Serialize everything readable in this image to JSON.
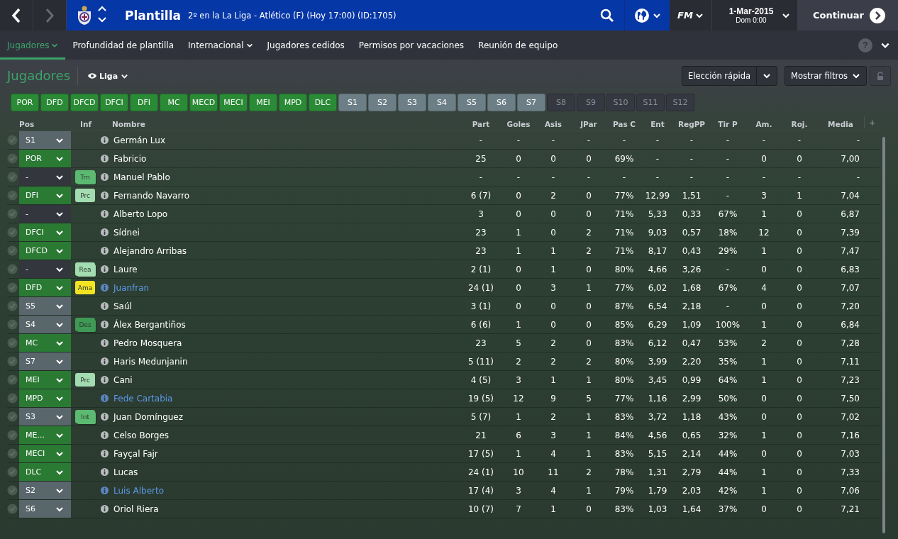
{
  "topbar": {
    "back_disabled": false,
    "forward_disabled": true,
    "title": "Plantilla",
    "subtitle": "2º en la La Liga - Atlético (F) (Hoy 17:00) (ID:1705)",
    "logo": "FM",
    "date": "1-Mar-2015",
    "time": "Dom 0:00",
    "continue": "Continuar"
  },
  "nav": [
    {
      "label": "Jugadores",
      "selected": true,
      "has_menu": true
    },
    {
      "label": "Profundidad de plantilla",
      "selected": false,
      "has_menu": false
    },
    {
      "label": "Internacional",
      "selected": false,
      "has_menu": true
    },
    {
      "label": "Jugadores cedidos",
      "selected": false,
      "has_menu": false
    },
    {
      "label": "Permisos por vacaciones",
      "selected": false,
      "has_menu": false
    },
    {
      "label": "Reunión de equipo",
      "selected": false,
      "has_menu": false
    }
  ],
  "help": "?",
  "panel": {
    "title": "Jugadores",
    "view": "Liga",
    "quick_pick": "Elección rápida",
    "filters": "Mostrar filtros"
  },
  "chips": [
    {
      "label": "POR",
      "kind": "starter"
    },
    {
      "label": "DFD",
      "kind": "starter"
    },
    {
      "label": "DFCD",
      "kind": "starter"
    },
    {
      "label": "DFCI",
      "kind": "starter"
    },
    {
      "label": "DFI",
      "kind": "starter"
    },
    {
      "label": "MC",
      "kind": "starter"
    },
    {
      "label": "MECD",
      "kind": "starter"
    },
    {
      "label": "MECI",
      "kind": "starter"
    },
    {
      "label": "MEI",
      "kind": "starter"
    },
    {
      "label": "MPD",
      "kind": "starter"
    },
    {
      "label": "DLC",
      "kind": "starter"
    },
    {
      "label": "S1",
      "kind": "sub"
    },
    {
      "label": "S2",
      "kind": "sub"
    },
    {
      "label": "S3",
      "kind": "sub"
    },
    {
      "label": "S4",
      "kind": "sub"
    },
    {
      "label": "S5",
      "kind": "sub"
    },
    {
      "label": "S6",
      "kind": "sub"
    },
    {
      "label": "S7",
      "kind": "sub"
    },
    {
      "label": "S8",
      "kind": "empty"
    },
    {
      "label": "S9",
      "kind": "empty"
    },
    {
      "label": "S10",
      "kind": "empty"
    },
    {
      "label": "S11",
      "kind": "empty"
    },
    {
      "label": "S12",
      "kind": "empty"
    }
  ],
  "table": {
    "pos_header": "Pos",
    "inf_header": "Inf",
    "name_header": "Nombre",
    "columns": [
      "Part",
      "Goles",
      "Asis",
      "JPar",
      "Pas C",
      "Ent",
      "RegPP",
      "Tir P",
      "Am.",
      "Roj.",
      "Media"
    ],
    "add": "+",
    "rows": [
      {
        "pos": {
          "label": "S1",
          "kind": "sub"
        },
        "name": "Germán Lux",
        "highlighted": false,
        "stats": [
          "-",
          "-",
          "-",
          "-",
          "-",
          "-",
          "-",
          "-",
          "-",
          "-",
          "-"
        ]
      },
      {
        "pos": {
          "label": "POR",
          "kind": "starter"
        },
        "name": "Fabricio",
        "highlighted": false,
        "stats": [
          "25",
          "0",
          "0",
          "0",
          "69%",
          "-",
          "-",
          "-",
          "0",
          "0",
          "7,00"
        ]
      },
      {
        "pos": {
          "label": "-",
          "kind": "none"
        },
        "badge": {
          "label": "Trn",
          "color": "#5cb971",
          "stacked": true
        },
        "name": "Manuel Pablo",
        "highlighted": false,
        "stats": [
          "-",
          "-",
          "-",
          "-",
          "-",
          "-",
          "-",
          "-",
          "-",
          "-",
          "-"
        ]
      },
      {
        "pos": {
          "label": "DFI",
          "kind": "starter"
        },
        "badge": {
          "label": "Prc",
          "color": "#a3dcb0",
          "stacked": false
        },
        "name": "Fernando Navarro",
        "highlighted": false,
        "stats": [
          "6 (7)",
          "0",
          "2",
          "0",
          "77%",
          "12,99",
          "1,51",
          "-",
          "3",
          "1",
          "7,04"
        ]
      },
      {
        "pos": {
          "label": "-",
          "kind": "none"
        },
        "name": "Alberto Lopo",
        "highlighted": false,
        "stats": [
          "3",
          "0",
          "0",
          "0",
          "71%",
          "5,33",
          "0,33",
          "67%",
          "1",
          "0",
          "6,87"
        ]
      },
      {
        "pos": {
          "label": "DFCI",
          "kind": "starter"
        },
        "name": "Sídnei",
        "highlighted": false,
        "stats": [
          "23",
          "1",
          "0",
          "2",
          "71%",
          "9,03",
          "0,57",
          "18%",
          "12",
          "0",
          "7,39"
        ]
      },
      {
        "pos": {
          "label": "DFCD",
          "kind": "starter"
        },
        "name": "Alejandro Arribas",
        "highlighted": false,
        "stats": [
          "23",
          "1",
          "1",
          "2",
          "71%",
          "8,17",
          "0,43",
          "29%",
          "1",
          "0",
          "7,47"
        ]
      },
      {
        "pos": {
          "label": "-",
          "kind": "none"
        },
        "badge": {
          "label": "Rea",
          "color": "#a3dcb0",
          "stacked": true
        },
        "name": "Laure",
        "highlighted": false,
        "stats": [
          "2 (1)",
          "0",
          "1",
          "0",
          "80%",
          "4,66",
          "3,26",
          "-",
          "0",
          "0",
          "6,83"
        ]
      },
      {
        "pos": {
          "label": "DFD",
          "kind": "starter"
        },
        "badge": {
          "label": "Ama",
          "color": "#f2e422",
          "stacked": false
        },
        "name": "Juanfran",
        "highlighted": true,
        "stats": [
          "24 (1)",
          "0",
          "3",
          "1",
          "77%",
          "6,02",
          "1,68",
          "67%",
          "4",
          "0",
          "7,07"
        ]
      },
      {
        "pos": {
          "label": "S5",
          "kind": "sub"
        },
        "name": "Saúl",
        "highlighted": false,
        "stats": [
          "3 (1)",
          "0",
          "0",
          "0",
          "87%",
          "6,54",
          "2,18",
          "-",
          "0",
          "0",
          "7,20"
        ]
      },
      {
        "pos": {
          "label": "S4",
          "kind": "sub"
        },
        "badge": {
          "label": "Des",
          "color": "#3f9a55",
          "stacked": true
        },
        "name": "Álex Bergantiños",
        "highlighted": false,
        "stats": [
          "6 (6)",
          "1",
          "0",
          "0",
          "85%",
          "6,29",
          "1,09",
          "100%",
          "1",
          "0",
          "6,84"
        ]
      },
      {
        "pos": {
          "label": "MC",
          "kind": "starter"
        },
        "name": "Pedro Mosquera",
        "highlighted": false,
        "stats": [
          "23",
          "5",
          "2",
          "0",
          "83%",
          "6,12",
          "0,47",
          "53%",
          "2",
          "0",
          "7,28"
        ]
      },
      {
        "pos": {
          "label": "S7",
          "kind": "sub"
        },
        "name": "Haris Medunjanin",
        "highlighted": false,
        "stats": [
          "5 (11)",
          "2",
          "2",
          "2",
          "80%",
          "3,99",
          "2,20",
          "35%",
          "1",
          "0",
          "7,11"
        ]
      },
      {
        "pos": {
          "label": "MEI",
          "kind": "starter"
        },
        "badge": {
          "label": "Prc",
          "color": "#a3dcb0",
          "stacked": false
        },
        "name": "Cani",
        "highlighted": false,
        "stats": [
          "4 (5)",
          "3",
          "1",
          "1",
          "80%",
          "3,45",
          "0,99",
          "64%",
          "1",
          "0",
          "7,23"
        ]
      },
      {
        "pos": {
          "label": "MPD",
          "kind": "starter"
        },
        "name": "Fede Cartabia",
        "highlighted": true,
        "stats": [
          "19 (5)",
          "12",
          "9",
          "5",
          "77%",
          "1,16",
          "2,99",
          "50%",
          "0",
          "0",
          "7,50"
        ]
      },
      {
        "pos": {
          "label": "S3",
          "kind": "sub"
        },
        "badge": {
          "label": "Int",
          "color": "#5cb971",
          "stacked": true
        },
        "name": "Juan Domínguez",
        "highlighted": false,
        "stats": [
          "5 (7)",
          "1",
          "2",
          "1",
          "83%",
          "3,72",
          "1,18",
          "43%",
          "0",
          "0",
          "7,02"
        ]
      },
      {
        "pos": {
          "label": "ME...",
          "kind": "starter"
        },
        "name": "Celso Borges",
        "highlighted": false,
        "stats": [
          "21",
          "6",
          "3",
          "1",
          "84%",
          "4,56",
          "0,65",
          "32%",
          "1",
          "0",
          "7,16"
        ]
      },
      {
        "pos": {
          "label": "MECI",
          "kind": "starter"
        },
        "name": "Fayçal Fajr",
        "highlighted": false,
        "stats": [
          "17 (5)",
          "1",
          "4",
          "1",
          "83%",
          "5,15",
          "2,14",
          "44%",
          "0",
          "0",
          "7,03"
        ]
      },
      {
        "pos": {
          "label": "DLC",
          "kind": "starter"
        },
        "name": "Lucas",
        "highlighted": false,
        "stats": [
          "24 (1)",
          "10",
          "11",
          "2",
          "78%",
          "1,31",
          "2,79",
          "44%",
          "1",
          "0",
          "7,33"
        ]
      },
      {
        "pos": {
          "label": "S2",
          "kind": "sub"
        },
        "name": "Luis Alberto",
        "highlighted": true,
        "stats": [
          "17 (4)",
          "3",
          "4",
          "1",
          "79%",
          "1,79",
          "2,03",
          "42%",
          "1",
          "0",
          "7,06"
        ]
      },
      {
        "pos": {
          "label": "S6",
          "kind": "sub"
        },
        "name": "Oriol Riera",
        "highlighted": false,
        "stats": [
          "10 (7)",
          "7",
          "1",
          "0",
          "83%",
          "1,03",
          "1,64",
          "37%",
          "0",
          "0",
          "7,21"
        ]
      }
    ]
  }
}
